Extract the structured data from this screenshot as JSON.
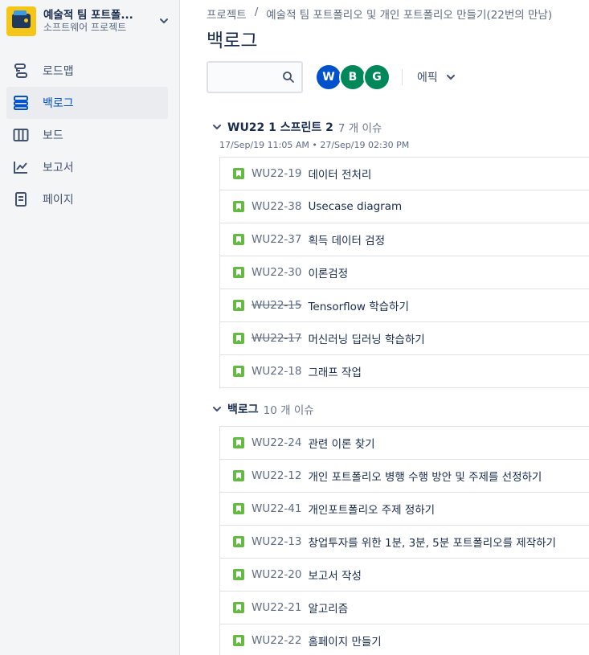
{
  "project": {
    "name": "예술적 팀 포트폴...",
    "type": "소프트웨어 프로젝트"
  },
  "nav": [
    {
      "label": "로드맵",
      "icon": "roadmap-icon",
      "active": false
    },
    {
      "label": "백로그",
      "icon": "backlog-icon",
      "active": true
    },
    {
      "label": "보드",
      "icon": "board-icon",
      "active": false
    },
    {
      "label": "보고서",
      "icon": "reports-icon",
      "active": false
    },
    {
      "label": "페이지",
      "icon": "pages-icon",
      "active": false
    }
  ],
  "breadcrumb": {
    "projects": "프로젝트",
    "separator": "/",
    "current": "예술적 팀 포트폴리오 및 개인 포트폴리오 만들기(22번의 만남)"
  },
  "page_title": "백로그",
  "toolbar": {
    "search_placeholder": "",
    "avatars": [
      {
        "initial": "W",
        "color": "#0052cc"
      },
      {
        "initial": "B",
        "color": "#00875a"
      },
      {
        "initial": "G",
        "color": "#00875a"
      }
    ],
    "epic_label": "에픽"
  },
  "sprint": {
    "name": "WU22 1 스프린트 2",
    "count": "7 개 이슈",
    "dates": "17/Sep/19 11:05 AM • 27/Sep/19 02:30 PM",
    "issues": [
      {
        "key": "WU22-19",
        "summary": "데이터 전처리",
        "done": false
      },
      {
        "key": "WU22-38",
        "summary": "Usecase diagram",
        "done": false
      },
      {
        "key": "WU22-37",
        "summary": "획득 데이터 검정",
        "done": false
      },
      {
        "key": "WU22-30",
        "summary": "이론검정",
        "done": false
      },
      {
        "key": "WU22-15",
        "summary": "Tensorflow 학습하기",
        "done": true
      },
      {
        "key": "WU22-17",
        "summary": "머신러닝 딥러닝 학습하기",
        "done": true
      },
      {
        "key": "WU22-18",
        "summary": "그래프 작업",
        "done": false
      }
    ]
  },
  "backlog": {
    "name": "백로그",
    "count": "10 개 이슈",
    "issues": [
      {
        "key": "WU22-24",
        "summary": "관련 이론 찾기",
        "done": false
      },
      {
        "key": "WU22-12",
        "summary": "개인 포트폴리오 병행 수행 방안 및 주제를 선정하기",
        "done": false
      },
      {
        "key": "WU22-41",
        "summary": "개인포트폴리오 주제 정하기",
        "done": false
      },
      {
        "key": "WU22-13",
        "summary": "창업투자를 위한 1분, 3분, 5분 포트폴리오를 제작하기",
        "done": false
      },
      {
        "key": "WU22-20",
        "summary": "보고서 작성",
        "done": false
      },
      {
        "key": "WU22-21",
        "summary": "알고리즘",
        "done": false
      },
      {
        "key": "WU22-22",
        "summary": "홈페이지 만들기",
        "done": false
      }
    ]
  },
  "colors": {
    "accent": "#0052cc",
    "story": "#65ba43",
    "sidebar_bg": "#f4f5f7"
  }
}
